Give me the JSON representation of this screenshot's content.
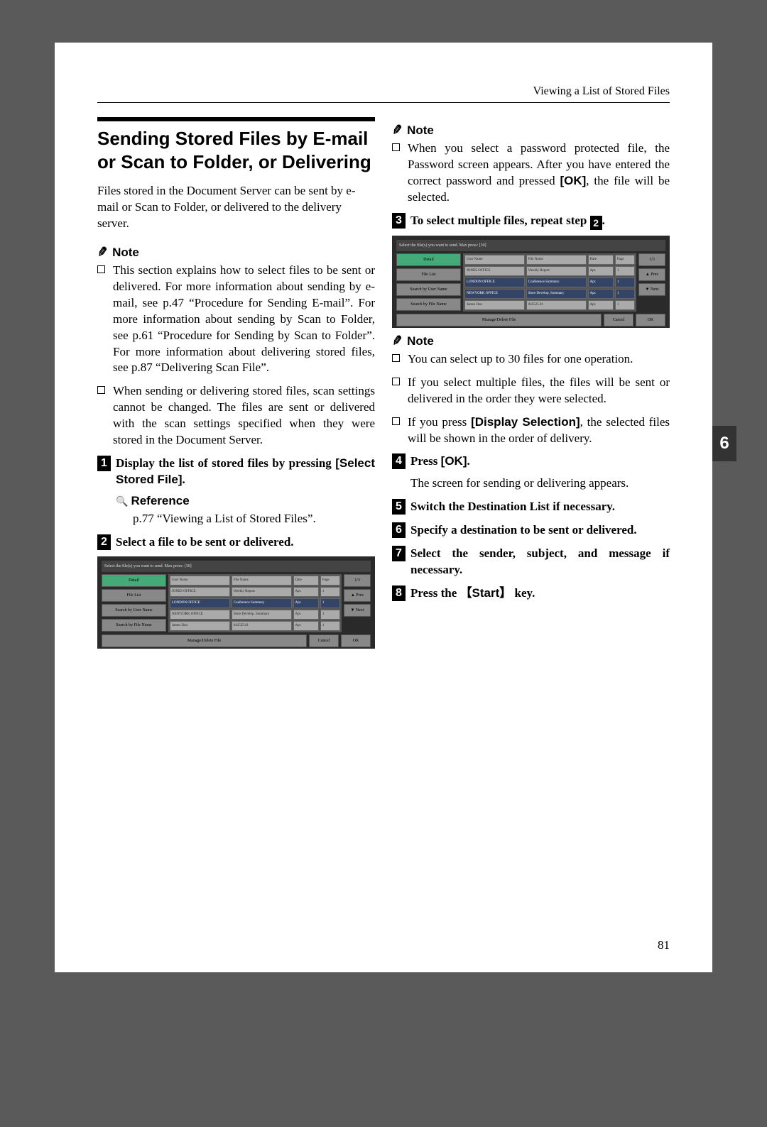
{
  "header": {
    "breadcrumb": "Viewing a List of Stored Files"
  },
  "title": "Sending Stored Files by E-mail or Scan to Folder, or Delivering",
  "intro": "Files stored in the Document Server can be sent by e-mail or Scan to Folder, or delivered to the delivery server.",
  "notes1": {
    "label": "Note",
    "items": [
      "This section explains how to select files to be sent or delivered. For more information about sending by e-mail, see p.47 “Procedure for Sending E-mail”. For more information about sending by Scan to Folder, see p.61 “Procedure for Sending by Scan to Folder”. For more information about delivering stored files, see p.87 “Delivering Scan File”.",
      "When sending or delivering stored files, scan settings cannot be changed. The files are sent or delivered with the scan settings specified when they were stored in the Document Server."
    ]
  },
  "stepA": {
    "num": "1",
    "text_pre": "Display the list of stored files by pressing ",
    "key": "[Select Stored File]",
    "text_post": "."
  },
  "reference": {
    "label": "Reference",
    "text": "p.77 “Viewing a List of Stored Files”."
  },
  "stepB": {
    "num": "2",
    "text": "Select a file to be sent or delivered."
  },
  "notes2": {
    "label": "Note",
    "items_pre": "When you select a password protected file, the Password screen appears. After you have entered the correct password and pressed ",
    "key": "[OK]",
    "items_post": ", the file will be selected."
  },
  "stepC": {
    "num": "3",
    "text_pre": "To select multiple files, repeat step ",
    "ref_step": "2",
    "text_post": "."
  },
  "notes3": {
    "label": "Note",
    "item1": "You can select up to 30 files for one operation.",
    "item2": "If you select multiple files, the files will be sent or delivered in the order they were selected.",
    "item3_pre": "If you press ",
    "item3_key": "[Display Selection]",
    "item3_post": ", the selected files will be shown in the order of delivery."
  },
  "stepD": {
    "num": "4",
    "text_pre": "Press ",
    "key": "[OK]",
    "text_post": "."
  },
  "stepD_body": "The screen for sending or delivering appears.",
  "stepE": {
    "num": "5",
    "text": "Switch the Destination List if necessary."
  },
  "stepF": {
    "num": "6",
    "text": "Specify a destination to be sent or delivered."
  },
  "stepG": {
    "num": "7",
    "text": "Select the sender, subject, and message if necessary."
  },
  "stepH": {
    "num": "8",
    "text_pre": "Press the ",
    "key": "【Start】",
    "text_post": " key."
  },
  "tab": "6",
  "page_number": "81",
  "screenshot": {
    "top": "Select the file(s) you want to send. Max press: [30]",
    "left_btns": [
      "Detail",
      "File List",
      "Search by User Name",
      "Search by File Name"
    ],
    "headers": [
      "User Name",
      "File Name",
      "Date",
      "Page"
    ],
    "rows": [
      [
        "JONES  OFFICE",
        "Weekly Report",
        "Apr.",
        "1"
      ],
      [
        "LONDON OFFICE",
        "Conference Summary",
        "Apr.",
        "1"
      ],
      [
        "NEWYORK OFFICE",
        "Store Develop. Summary",
        "Apr.",
        "1"
      ],
      [
        "James Dun",
        "042525.01",
        "Apr.",
        "1"
      ]
    ],
    "right": [
      "1/3",
      "▲ Prev",
      "▼ Next"
    ],
    "bottom_btn": "Manage/Delete File",
    "ok": "OK",
    "cancel": "Cancel"
  }
}
